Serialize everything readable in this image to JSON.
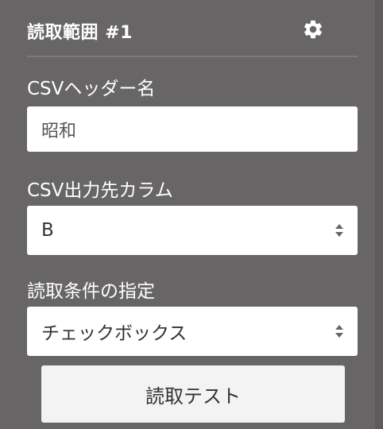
{
  "panel": {
    "title": "読取範囲 #1",
    "settings_icon": "gear-icon"
  },
  "csv_header": {
    "label": "CSVヘッダー名",
    "value": "昭和"
  },
  "csv_column": {
    "label": "CSV出力先カラム",
    "selected": "B",
    "icon": "select-arrows-icon"
  },
  "read_condition": {
    "label": "読取条件の指定",
    "selected": "チェックボックス",
    "icon": "select-arrows-icon"
  },
  "test_button": {
    "label": "読取テスト"
  }
}
